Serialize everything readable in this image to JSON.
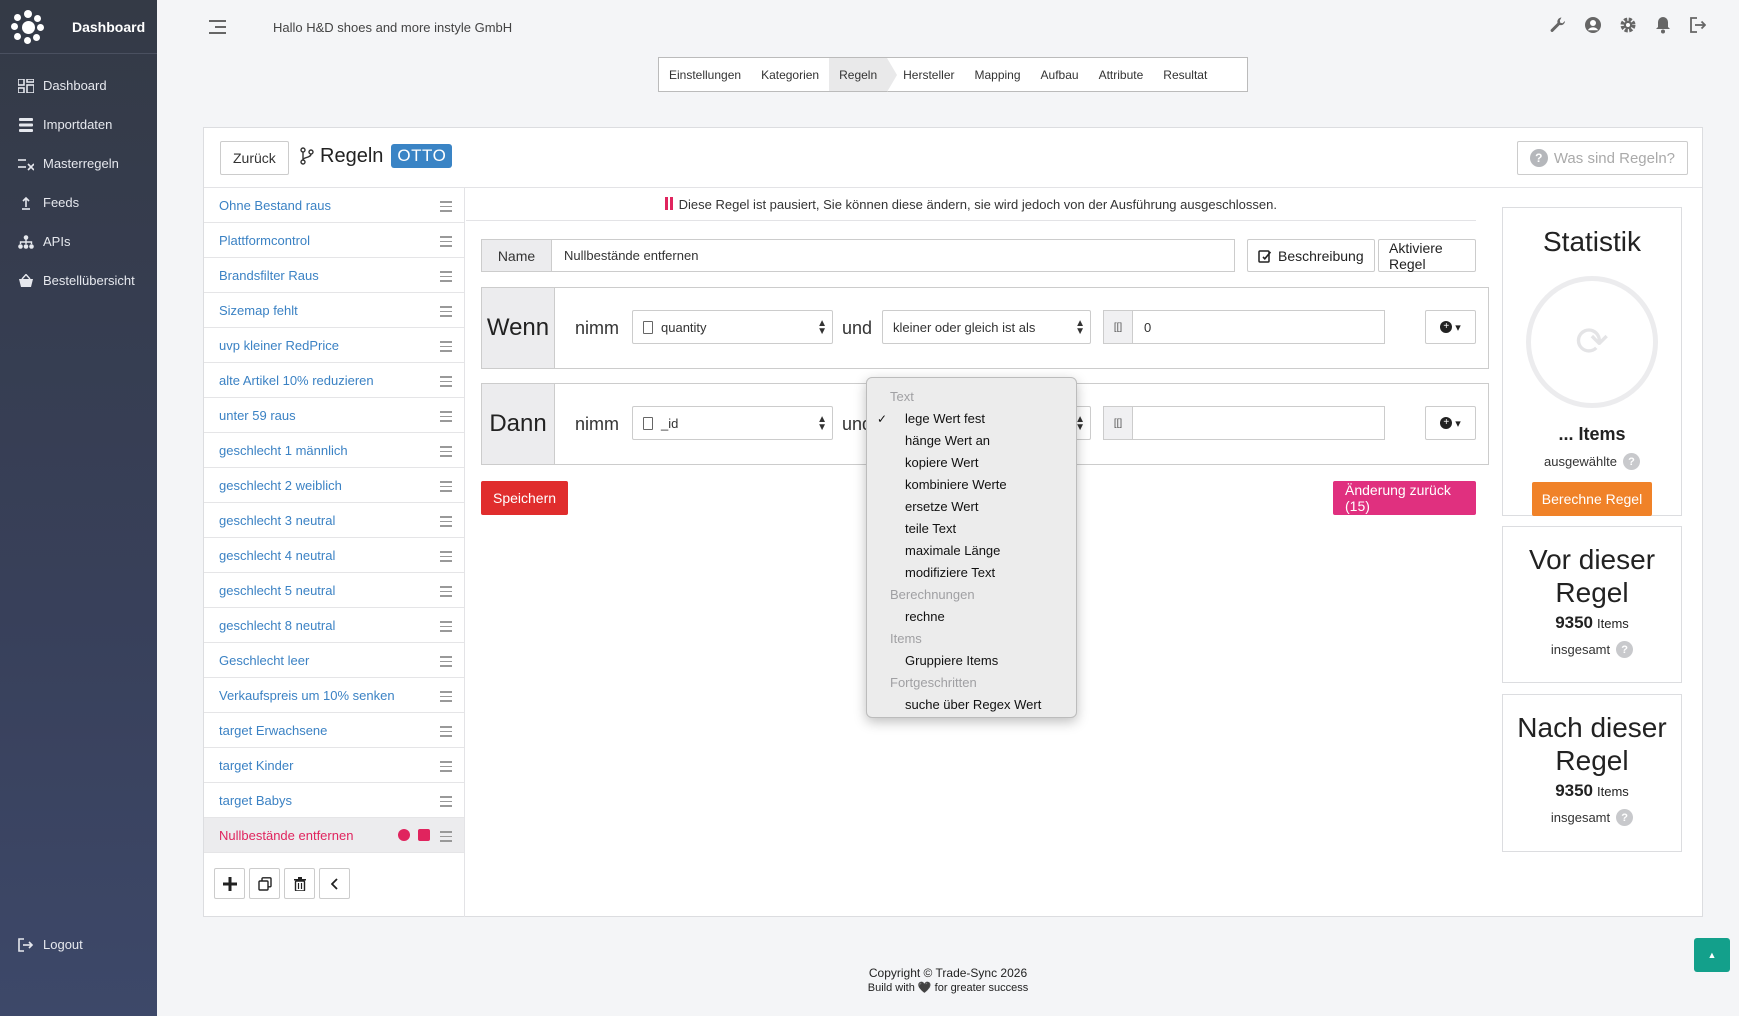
{
  "sidebar": {
    "brand": "Dashboard",
    "items": [
      {
        "label": "Dashboard",
        "icon": "dashboard-icon"
      },
      {
        "label": "Importdaten",
        "icon": "database-icon"
      },
      {
        "label": "Masterregeln",
        "icon": "rules-icon"
      },
      {
        "label": "Feeds",
        "icon": "upload-icon"
      },
      {
        "label": "APIs",
        "icon": "sitemap-icon"
      },
      {
        "label": "Bestellübersicht",
        "icon": "basket-icon"
      }
    ],
    "logout": "Logout"
  },
  "header": {
    "greeting": "Hallo H&D shoes and more instyle GmbH",
    "icons": [
      "wrench-icon",
      "user-icon",
      "gear-icon",
      "bell-icon",
      "logout-icon"
    ]
  },
  "steps": [
    "Einstellungen",
    "Kategorien",
    "Regeln",
    "Hersteller",
    "Mapping",
    "Aufbau",
    "Attribute",
    "Resultat"
  ],
  "active_step": "Regeln",
  "card": {
    "back_label": "Zurück",
    "title": "Regeln",
    "badge": "OTTO",
    "help_label": "Was sind Regeln?"
  },
  "rules": [
    "Ohne Bestand raus",
    "Plattformcontrol",
    "Brandsfilter Raus",
    "Sizemap fehlt",
    "uvp kleiner RedPrice",
    "alte Artikel 10% reduzieren",
    "unter 59 raus",
    "geschlecht 1 männlich",
    "geschlecht 2 weiblich",
    "geschlecht 3 neutral",
    "geschlecht 4 neutral",
    "geschlecht 5 neutral",
    "geschlecht 8 neutral",
    "Geschlecht leer",
    "Verkaufspreis um 10% senken",
    "target Erwachsene",
    "target Kinder",
    "target Babys"
  ],
  "active_rule": "Nullbestände entfernen",
  "editor": {
    "paused_note": "Diese Regel ist pausiert, Sie können diese ändern, sie wird jedoch von der Ausführung ausgeschlossen.",
    "name_label": "Name",
    "name_value": "Nullbestände entfernen",
    "description_btn": "Beschreibung",
    "activate_btn": "Aktiviere Regel",
    "wenn": {
      "lead": "Wenn",
      "nimm": "nimm",
      "field": "quantity",
      "und": "und",
      "operator": "kleiner oder gleich ist als",
      "value": "0"
    },
    "dann": {
      "lead": "Dann",
      "nimm": "nimm",
      "field": "_id",
      "und": "und",
      "value": ""
    },
    "save_btn": "Speichern",
    "revert_btn": "Änderung zurück (15)"
  },
  "dropdown": {
    "groups": [
      {
        "label": "Text",
        "options": [
          "lege Wert fest",
          "hänge Wert an",
          "kopiere Wert",
          "kombiniere Werte",
          "ersetze Wert",
          "teile Text",
          "maximale Länge",
          "modifiziere Text"
        ]
      },
      {
        "label": "Berechnungen",
        "options": [
          "rechne"
        ]
      },
      {
        "label": "Items",
        "options": [
          "Gruppiere Items"
        ]
      },
      {
        "label": "Fortgeschritten",
        "options": [
          "suche über Regex Wert"
        ]
      }
    ],
    "selected": "lege Wert fest"
  },
  "stats": {
    "title": "Statistik",
    "items_label": "... Items",
    "selected_label": "ausgewählte",
    "calc_btn": "Berechne Regel",
    "before_title": "Vor dieser Regel",
    "before_count": "9350",
    "after_title": "Nach dieser Regel",
    "after_count": "9350",
    "items_unit": "Items",
    "total_label": "insgesamt"
  },
  "footer": {
    "copyright": "Copyright © Trade-Sync 2026",
    "built_with": "Build with",
    "built_suffix": "for greater success"
  },
  "colors": {
    "sidebar_bg": "#38405a",
    "link": "#3b82c4",
    "active_rule": "#e0245e",
    "save": "#e02d2d",
    "revert": "#e0307f",
    "calc": "#f08228",
    "badge": "#3a84c5",
    "up_button": "#13a08b"
  }
}
